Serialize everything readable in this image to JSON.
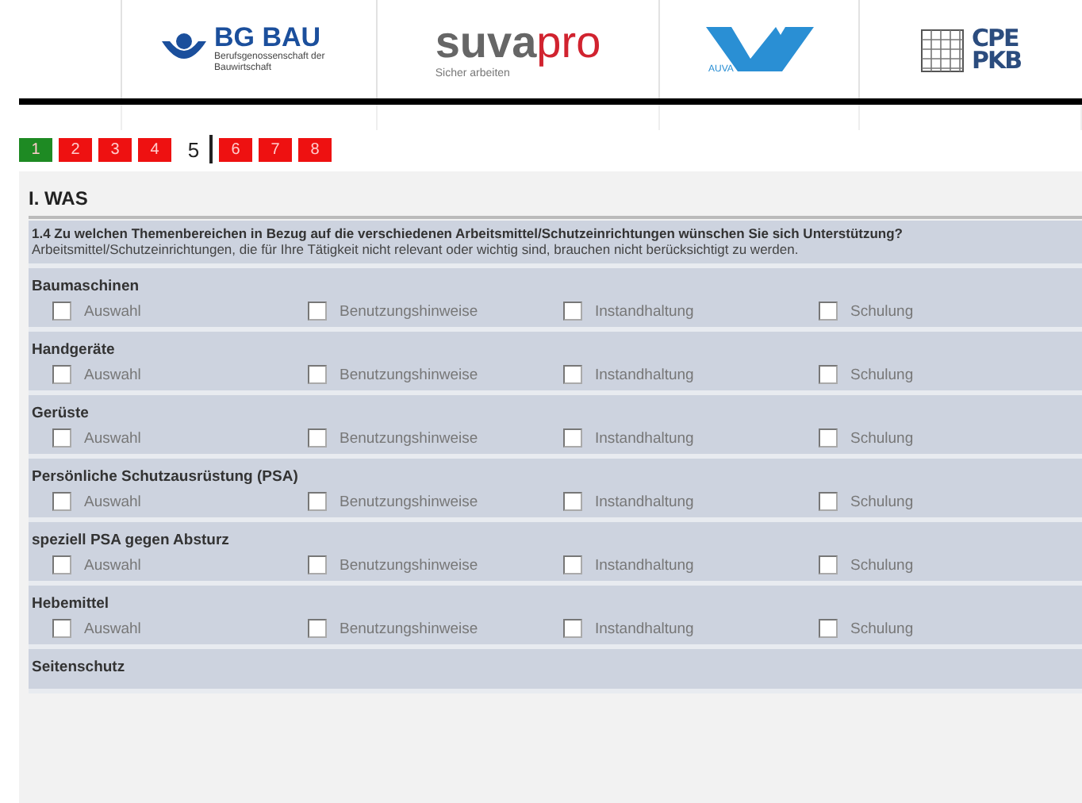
{
  "header": {
    "logos": [
      {
        "kind": "bgbau",
        "title": "BG BAU",
        "subtitle": "Berufsgenossenschaft der Bauwirtschaft"
      },
      {
        "kind": "suva",
        "title": "suva",
        "title_accent": "pro",
        "subtitle": "Sicher arbeiten"
      },
      {
        "kind": "auva",
        "title": "AUVA"
      },
      {
        "kind": "cpe",
        "title": "CPE",
        "subtitle": "PKB"
      }
    ]
  },
  "steps": [
    {
      "label": "1",
      "color": "#1e8a23",
      "selected": false
    },
    {
      "label": "2",
      "color": "#ee1111",
      "selected": false
    },
    {
      "label": "3",
      "color": "#ee1111",
      "selected": false
    },
    {
      "label": "4",
      "color": "#ee1111",
      "selected": false
    },
    {
      "label": "5",
      "selected": true
    },
    {
      "label": "6",
      "color": "#ee1111",
      "selected": false
    },
    {
      "label": "7",
      "color": "#ee1111",
      "selected": false
    },
    {
      "label": "8",
      "color": "#ee1111",
      "selected": false
    }
  ],
  "section": {
    "title": "I. WAS",
    "question": "**1.4 Zu welchen Themenbereichen in Bezug auf die verschiedenen Arbeitsmittel/Schutzeinrichtungen wünschen Sie sich Unterstützung?** Arbeitsmittel/Schutzeinrichtungen, die für Ihre Tätigkeit nicht relevant oder wichtig sind, brauchen nicht berücksichtigt zu werden.",
    "groups": [
      {
        "label": "Baumaschinen",
        "options": [
          {
            "label": "Auswahl",
            "checked": false
          },
          {
            "label": "Benutzungshinweise",
            "checked": false
          },
          {
            "label": "Instandhaltung",
            "checked": false
          },
          {
            "label": "Schulung",
            "checked": false
          }
        ]
      },
      {
        "label": "Handgeräte",
        "options": [
          {
            "label": "Auswahl",
            "checked": false
          },
          {
            "label": "Benutzungshinweise",
            "checked": false
          },
          {
            "label": "Instandhaltung",
            "checked": false
          },
          {
            "label": "Schulung",
            "checked": false
          }
        ]
      },
      {
        "label": "Gerüste",
        "options": [
          {
            "label": "Auswahl",
            "checked": false
          },
          {
            "label": "Benutzungshinweise",
            "checked": false
          },
          {
            "label": "Instandhaltung",
            "checked": false
          },
          {
            "label": "Schulung",
            "checked": false
          }
        ]
      },
      {
        "label": "Persönliche Schutzausrüstung (PSA)",
        "options": [
          {
            "label": "Auswahl",
            "checked": false
          },
          {
            "label": "Benutzungshinweise",
            "checked": false
          },
          {
            "label": "Instandhaltung",
            "checked": false
          },
          {
            "label": "Schulung",
            "checked": false
          }
        ]
      },
      {
        "label": "speziell PSA gegen Absturz",
        "options": [
          {
            "label": "Auswahl",
            "checked": false
          },
          {
            "label": "Benutzungshinweise",
            "checked": false
          },
          {
            "label": "Instandhaltung",
            "checked": false
          },
          {
            "label": "Schulung",
            "checked": false
          }
        ]
      },
      {
        "label": "Hebemittel",
        "options": [
          {
            "label": "Auswahl",
            "checked": false
          },
          {
            "label": "Benutzungshinweise",
            "checked": false
          },
          {
            "label": "Instandhaltung",
            "checked": false
          },
          {
            "label": "Schulung",
            "checked": false
          }
        ]
      },
      {
        "label": "Seitenschutz"
      }
    ]
  }
}
